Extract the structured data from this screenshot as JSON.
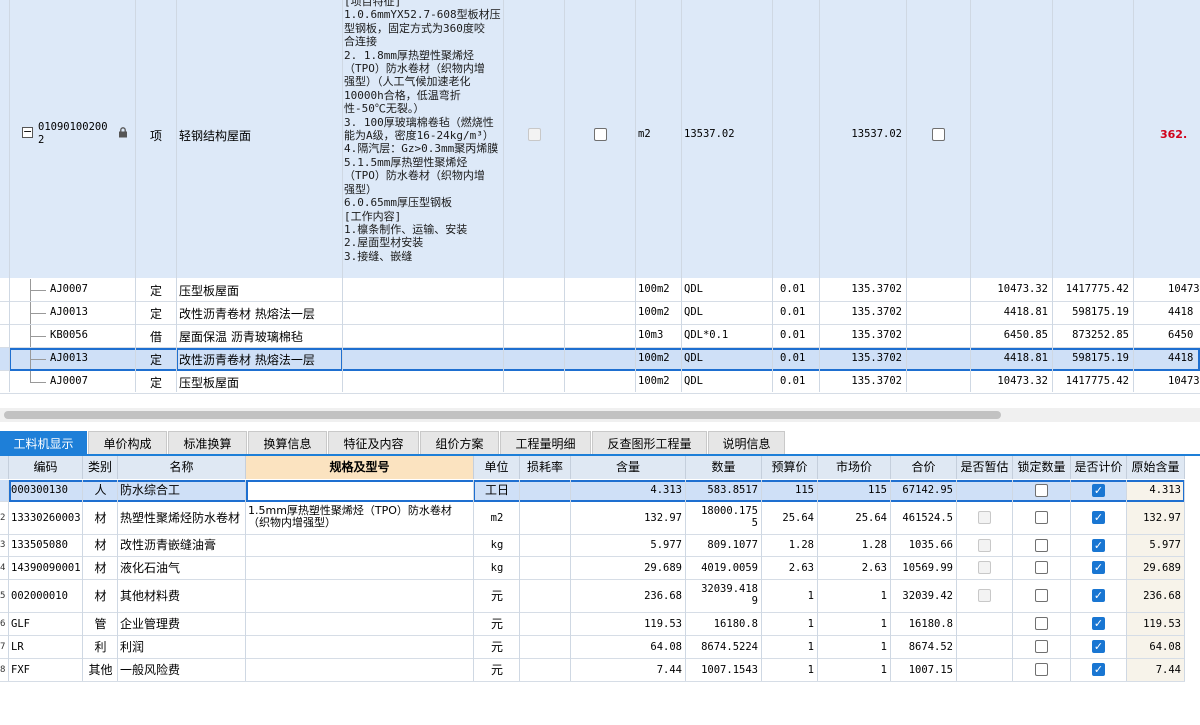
{
  "top": {
    "main_row": {
      "code_line1": "01090100200",
      "code_line2": "2",
      "type": "项",
      "name": "轻钢结构屋面",
      "desc": "[项目特征]\n1.0.6mmYX52.7-608型板材压\n型钢板，固定方式为360度咬\n合连接\n2. 1.8mm厚热塑性聚烯烃\n（TPO）防水卷材（织物内增\n强型）（人工气候加速老化\n10000h合格，低温弯折\n性-50℃无裂。）\n3. 100厚玻璃棉卷毡（燃烧性\n能为A级，密度16-24kg/m³）\n4.隔汽层：Gz>0.3mm聚丙烯膜\n5.1.5mm厚热塑性聚烯烃\n（TPO）防水卷材（织物内增\n强型）\n6.0.65mm厚压型钢板\n[工作内容]\n1.檩条制作、运输、安装\n2.屋面型材安装\n3.接缝、嵌缝",
      "unit": "m2",
      "qty_expr": "13537.02",
      "qty": "13537.02",
      "price_partial": "362."
    },
    "sub_rows": [
      {
        "code": "AJ0007",
        "type": "定",
        "name": "压型板屋面",
        "unit": "100m2",
        "expr": "QDL",
        "ratio": "0.01",
        "qty": "135.3702",
        "price": "10473.32",
        "total": "1417775.42",
        "extra": "10473"
      },
      {
        "code": "AJ0013",
        "type": "定",
        "name": "改性沥青卷材 热熔法一层",
        "unit": "100m2",
        "expr": "QDL",
        "ratio": "0.01",
        "qty": "135.3702",
        "price": "4418.81",
        "total": "598175.19",
        "extra": "4418"
      },
      {
        "code": "KB0056",
        "type": "借",
        "name": "屋面保温 沥青玻璃棉毡",
        "unit": "10m3",
        "expr": "QDL*0.1",
        "ratio": "0.01",
        "qty": "135.3702",
        "price": "6450.85",
        "total": "873252.85",
        "extra": "6450"
      },
      {
        "code": "AJ0013",
        "type": "定",
        "name": "改性沥青卷材 热熔法一层",
        "unit": "100m2",
        "expr": "QDL",
        "ratio": "0.01",
        "qty": "135.3702",
        "price": "4418.81",
        "total": "598175.19",
        "extra": "4418"
      },
      {
        "code": "AJ0007",
        "type": "定",
        "name": "压型板屋面",
        "unit": "100m2",
        "expr": "QDL",
        "ratio": "0.01",
        "qty": "135.3702",
        "price": "10473.32",
        "total": "1417775.42",
        "extra": "10473"
      }
    ]
  },
  "tabs": [
    "工料机显示",
    "单价构成",
    "标准换算",
    "换算信息",
    "特征及内容",
    "组价方案",
    "工程量明细",
    "反查图形工程量",
    "说明信息"
  ],
  "columns": [
    "编码",
    "类别",
    "名称",
    "规格及型号",
    "单位",
    "损耗率",
    "含量",
    "数量",
    "预算价",
    "市场价",
    "合价",
    "是否暂估",
    "锁定数量",
    "是否计价",
    "原始含量"
  ],
  "materials": [
    {
      "idx": "",
      "code": "000300130",
      "type": "人",
      "name": "防水综合工",
      "spec": "",
      "unit": "工日",
      "loss": "",
      "content": "4.313",
      "qty": "583.8517",
      "budget": "115",
      "market": "115",
      "total": "67142.95",
      "est": "",
      "orig": "4.313"
    },
    {
      "idx": "2",
      "code": "13330260003",
      "type": "材",
      "name": "热塑性聚烯烃防水卷材",
      "spec": "1.5mm厚热塑性聚烯烃（TPO）防水卷材\n（织物内增强型）",
      "unit": "m2",
      "loss": "",
      "content": "132.97",
      "qty": "18000.175\n5",
      "budget": "25.64",
      "market": "25.64",
      "total": "461524.5",
      "est": "dis",
      "orig": "132.97"
    },
    {
      "idx": "3",
      "code": "133505080",
      "type": "材",
      "name": "改性沥青嵌缝油膏",
      "spec": "",
      "unit": "kg",
      "loss": "",
      "content": "5.977",
      "qty": "809.1077",
      "budget": "1.28",
      "market": "1.28",
      "total": "1035.66",
      "est": "dis",
      "orig": "5.977"
    },
    {
      "idx": "4",
      "code": "14390090001",
      "type": "材",
      "name": "液化石油气",
      "spec": "",
      "unit": "kg",
      "loss": "",
      "content": "29.689",
      "qty": "4019.0059",
      "budget": "2.63",
      "market": "2.63",
      "total": "10569.99",
      "est": "dis",
      "orig": "29.689"
    },
    {
      "idx": "5",
      "code": "002000010",
      "type": "材",
      "name": "其他材料费",
      "spec": "",
      "unit": "元",
      "loss": "",
      "content": "236.68",
      "qty": "32039.418\n9",
      "budget": "1",
      "market": "1",
      "total": "32039.42",
      "est": "dis",
      "orig": "236.68"
    },
    {
      "idx": "6",
      "code": "GLF",
      "type": "管",
      "name": "企业管理费",
      "spec": "",
      "unit": "元",
      "loss": "",
      "content": "119.53",
      "qty": "16180.8",
      "budget": "1",
      "market": "1",
      "total": "16180.8",
      "est": "",
      "orig": "119.53"
    },
    {
      "idx": "7",
      "code": "LR",
      "type": "利",
      "name": "利润",
      "spec": "",
      "unit": "元",
      "loss": "",
      "content": "64.08",
      "qty": "8674.5224",
      "budget": "1",
      "market": "1",
      "total": "8674.52",
      "est": "",
      "orig": "64.08"
    },
    {
      "idx": "8",
      "code": "FXF",
      "type": "其他",
      "name": "一般风险费",
      "spec": "",
      "unit": "元",
      "loss": "",
      "content": "7.44",
      "qty": "1007.1543",
      "budget": "1",
      "market": "1",
      "total": "1007.15",
      "est": "",
      "orig": "7.44"
    }
  ],
  "colors": {
    "selected_row": "#cfe0f7",
    "header_bg": "#dfe8f3",
    "tab_active": "#1e7fd8",
    "price_red": "#d0021b"
  }
}
